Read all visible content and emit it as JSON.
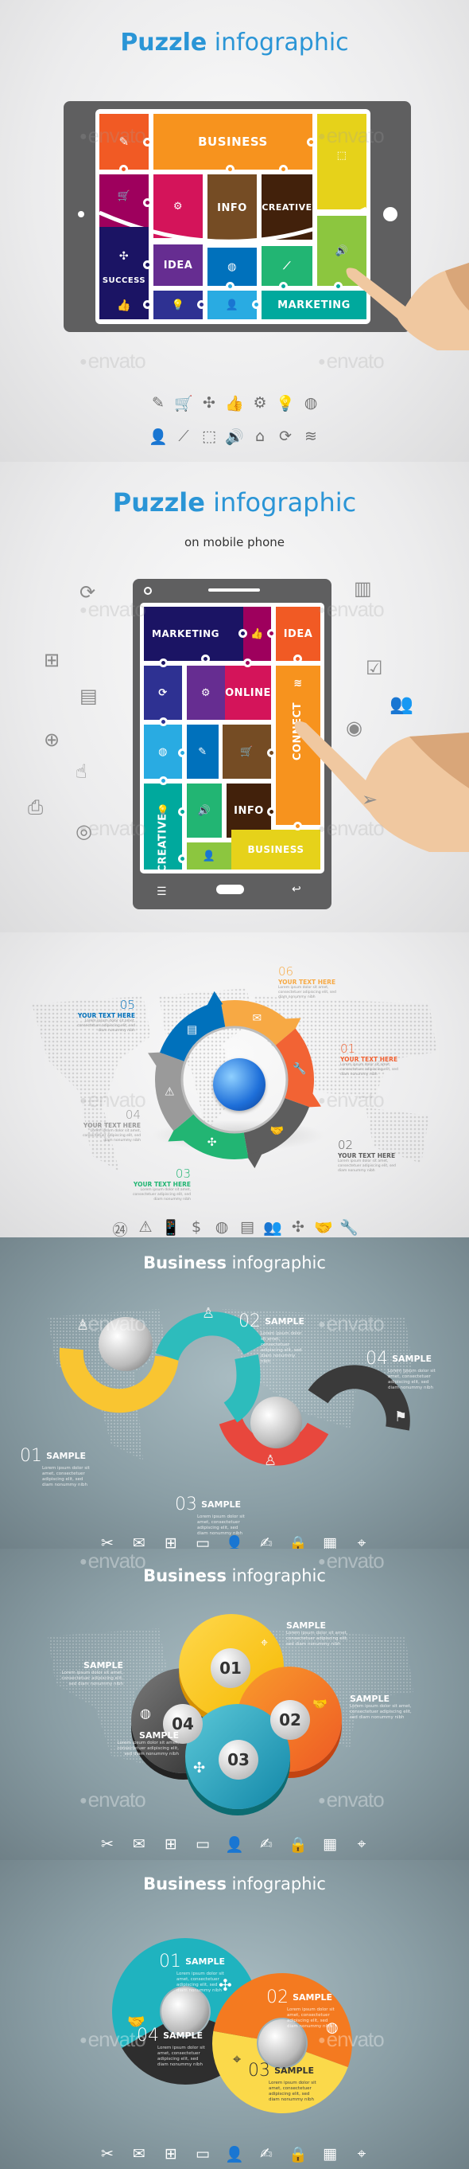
{
  "watermark": "envato",
  "section1": {
    "title_bold": "Puzzle",
    "title_light": "infographic",
    "pieces": {
      "business": "BUSINESS",
      "info": "INFO",
      "creative": "CREATIVE",
      "idea": "IDEA",
      "success": "SUCCESS",
      "marketing": "MARKETING"
    },
    "colors": {
      "title": "#2a95d6",
      "device": "#5f5f60",
      "orange_red": "#f15a24",
      "orange": "#f7931e",
      "yellow": "#e6d21a",
      "magenta": "#a0105e",
      "pink": "#d4145a",
      "brown": "#754c24",
      "dark_brown": "#42210b",
      "navy": "#1b1464",
      "purple": "#662d91",
      "blue": "#0071bc",
      "green": "#22b573",
      "lime": "#8cc63f",
      "indigo": "#2e3192",
      "sky": "#29abe2",
      "teal": "#00a99d",
      "skin": "#f0c8a0"
    },
    "icons_row1": [
      "pencil-icon",
      "cart-icon",
      "puzzle-icon",
      "thumbs-up-icon",
      "gears-icon",
      "bulb-icon",
      "globe-icon"
    ],
    "icons_row1_glyphs": [
      "✎",
      "🛒",
      "✣",
      "👍",
      "⚙",
      "💡",
      "◍"
    ],
    "icons_row2": [
      "user-icon",
      "chart-line-icon",
      "browser-cursor-icon",
      "speaker-icon",
      "basket-icon",
      "refresh-icon",
      "wifi-icon"
    ],
    "icons_row2_glyphs": [
      "👤",
      "⟋",
      "⬚",
      "🔊",
      "⌂",
      "⟳",
      "≋"
    ]
  },
  "section2": {
    "title_bold": "Puzzle",
    "title_light": "infographic",
    "subtitle": "on mobile phone",
    "pieces": {
      "marketing": "MARKETING",
      "idea": "IDEA",
      "online": "ONLINE",
      "connect": "CONNECT",
      "info": "INFO",
      "creative": "CREATIVE",
      "business": "BUSINESS"
    },
    "side_icons_left": [
      "refresh-icon",
      "sitemap-icon",
      "report-icon",
      "zoom-in-icon",
      "pointer-hand-icon",
      "printer-icon",
      "globe-grid-icon"
    ],
    "side_icons_left_glyphs": [
      "⟳",
      "⊞",
      "▤",
      "⊕",
      "☝",
      "⎙",
      "◎"
    ],
    "side_icons_right": [
      "bar-chart-icon",
      "notepad-check-icon",
      "users-icon",
      "disc-icon",
      "paper-plane-icon"
    ],
    "side_icons_right_glyphs": [
      "▥",
      "☑",
      "👥",
      "◉",
      "➢"
    ]
  },
  "section3": {
    "items": [
      {
        "num": "01",
        "label": "YOUR TEXT HERE",
        "text": "Lorem ipsum dolor sit amet, consectetuer adipiscing elit, sed diam nonummy nibh",
        "color": "#f26334"
      },
      {
        "num": "02",
        "label": "YOUR TEXT HERE",
        "text": "Lorem ipsum dolor sit amet, consectetuer adipiscing elit, sed diam nonummy nibh",
        "color": "#5d5d5d"
      },
      {
        "num": "03",
        "label": "YOUR TEXT HERE",
        "text": "Lorem ipsum dolor sit amet, consectetuer adipiscing elit, sed diam nonummy nibh",
        "color": "#22b573"
      },
      {
        "num": "04",
        "label": "YOUR TEXT HERE",
        "text": "Lorem ipsum dolor sit amet, consectetuer adipiscing elit, sed diam nonummy nibh",
        "color": "#9a9a9a"
      },
      {
        "num": "05",
        "label": "YOUR TEXT HERE",
        "text": "Lorem ipsum dolor sit amet, consectetuer adipiscing elit, sed diam nonummy nibh",
        "color": "#0071bc"
      },
      {
        "num": "06",
        "label": "YOUR TEXT HERE",
        "text": "Lorem ipsum dolor sit amet, consectetuer adipiscing elit, sed diam nonummy nibh",
        "color": "#f7a944"
      }
    ],
    "ring_icons": [
      "wrench-icon",
      "handshake-icon",
      "puzzle-icon",
      "warning-icon",
      "report-icon",
      "envelope-icon"
    ],
    "ring_icons_glyphs": [
      "🔧",
      "🤝",
      "✣",
      "⚠",
      "▤",
      "✉"
    ],
    "icons": [
      "24h-icon",
      "warning-icon",
      "sms-phone-icon",
      "dollar-icon",
      "globe-icon",
      "report-icon",
      "users-icon",
      "puzzle-icon",
      "handshake-icon",
      "wrench-icon"
    ],
    "icons_glyphs": [
      "㉔",
      "⚠",
      "📱",
      "$",
      "◍",
      "▤",
      "👥",
      "✣",
      "🤝",
      "🔧"
    ]
  },
  "section4": {
    "title_bold": "Business",
    "title_light": "infographic",
    "items": [
      {
        "num": "01",
        "label": "SAMPLE",
        "text": "Lorem ipsum dolor sit amet, consectetuer adipiscing elit, sed diam nonummy nibh"
      },
      {
        "num": "02",
        "label": "SAMPLE",
        "text": "Lorem ipsum dolor sit amet, consectetuer adipiscing elit, sed diam nonummy nibh"
      },
      {
        "num": "03",
        "label": "SAMPLE",
        "text": "Lorem ipsum dolor sit amet, consectetuer adipiscing elit, sed diam nonummy nibh"
      },
      {
        "num": "04",
        "label": "SAMPLE",
        "text": "Lorem ipsum dolor sit amet, consectetuer adipiscing elit, sed diam nonummy nibh"
      }
    ],
    "icons": [
      "tools-icon",
      "mail-icon",
      "sitemap-icon",
      "monitor-pulse-icon",
      "user-icon",
      "pen-sign-icon",
      "padlock-icon",
      "monitor-chart-icon",
      "map-pin-icon"
    ],
    "icons_glyphs": [
      "✂",
      "✉",
      "⊞",
      "▭",
      "👤",
      "✍",
      "🔒",
      "▦",
      "⌖"
    ]
  },
  "section5": {
    "title_bold": "Business",
    "title_light": "infographic",
    "items": [
      {
        "num": "01",
        "label": "SAMPLE",
        "text": "Lorem ipsum dolor sit amet, consectetuer adipiscing elit, sed diam nonummy nibh"
      },
      {
        "num": "02",
        "label": "SAMPLE",
        "text": "Lorem ipsum dolor sit amet, consectetuer adipiscing elit, sed diam nonummy nibh"
      },
      {
        "num": "03",
        "label": "SAMPLE",
        "text": "Lorem ipsum dolor sit amet, consectetuer adipiscing elit, sed diam nonummy nibh"
      },
      {
        "num": "04",
        "label": "SAMPLE",
        "text": "Lorem ipsum dolor sit amet, consectetuer adipiscing elit, sed diam nonummy nibh"
      }
    ],
    "icons": [
      "tools-icon",
      "mail-icon",
      "sitemap-icon",
      "monitor-pulse-icon",
      "user-icon",
      "pen-sign-icon",
      "padlock-icon",
      "monitor-chart-icon",
      "map-pin-icon"
    ],
    "icons_glyphs": [
      "✂",
      "✉",
      "⊞",
      "▭",
      "👤",
      "✍",
      "🔒",
      "▦",
      "⌖"
    ]
  },
  "section6": {
    "title_bold": "Business",
    "title_light": "infographic",
    "items": [
      {
        "num": "01",
        "label": "SAMPLE",
        "text": "Lorem ipsum dolor sit amet, consectetuer adipiscing elit, sed diam nonummy nibh"
      },
      {
        "num": "02",
        "label": "SAMPLE",
        "text": "Lorem ipsum dolor sit amet, consectetuer adipiscing elit, sed diam nonummy nibh"
      },
      {
        "num": "03",
        "label": "SAMPLE",
        "text": "Lorem ipsum dolor sit amet, consectetuer adipiscing elit, sed diam nonummy nibh"
      },
      {
        "num": "04",
        "label": "SAMPLE",
        "text": "Lorem ipsum dolor sit amet, consectetuer adipiscing elit, sed diam nonummy nibh"
      }
    ],
    "icons": [
      "tools-icon",
      "mail-icon",
      "sitemap-icon",
      "monitor-pulse-icon",
      "user-icon",
      "pen-sign-icon",
      "padlock-icon",
      "monitor-chart-icon",
      "map-pin-icon"
    ],
    "icons_glyphs": [
      "✂",
      "✉",
      "⊞",
      "▭",
      "👤",
      "✍",
      "🔒",
      "▦",
      "⌖"
    ]
  }
}
